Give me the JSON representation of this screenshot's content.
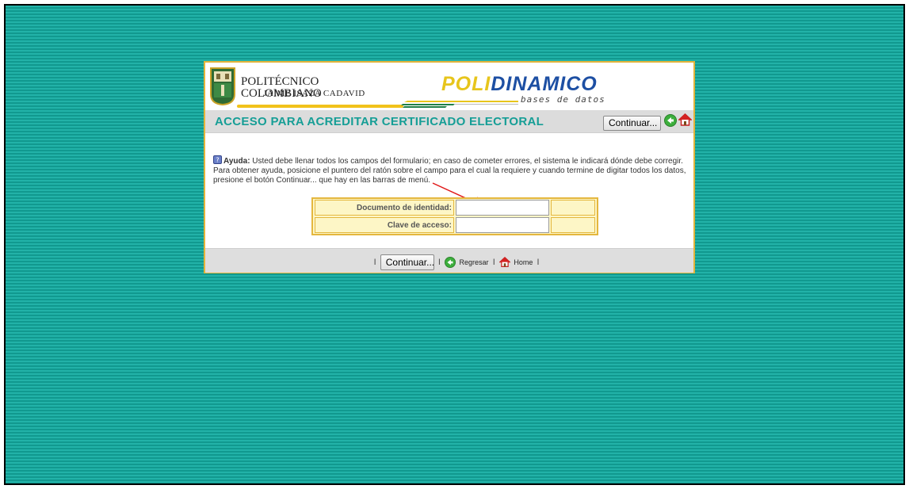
{
  "header": {
    "institution_name": "POLITÉCNICO COLOMBIANO",
    "institution_sub": "JAIME ISAZA CADAVID",
    "logo_part1": "POLI",
    "logo_part2": "DINAMICO",
    "logo_sub": "bases de datos"
  },
  "title_bar": {
    "title": "ACCESO PARA ACREDITAR CERTIFICADO ELECTORAL",
    "continue_label": "Continuar...",
    "back_icon": "back-arrow-icon",
    "home_icon": "home-icon"
  },
  "help": {
    "label": "Ayuda:",
    "text": " Usted debe llenar todos los campos del formulario; en caso de cometer errores, el sistema le indicará dónde debe corregir. Para obtener ayuda, posicione el puntero del ratón sobre el campo para el cual la requiere y cuando termine de digitar todos los datos, presione el botón Continuar... que hay en las barras de menú."
  },
  "form": {
    "document_label": "Documento de identidad:",
    "document_value": "",
    "password_label": "Clave de acceso:",
    "password_value": ""
  },
  "footer": {
    "separator": "l",
    "continue_label": "Continuar...",
    "back_label": "Regresar",
    "home_label": "Home"
  },
  "colors": {
    "background_teal": "#1aa89f",
    "title_teal": "#169e96",
    "panel_border_gold": "#e2b43a",
    "form_fill_yellow": "#fdf6c6",
    "arrow_red": "#e01818"
  }
}
